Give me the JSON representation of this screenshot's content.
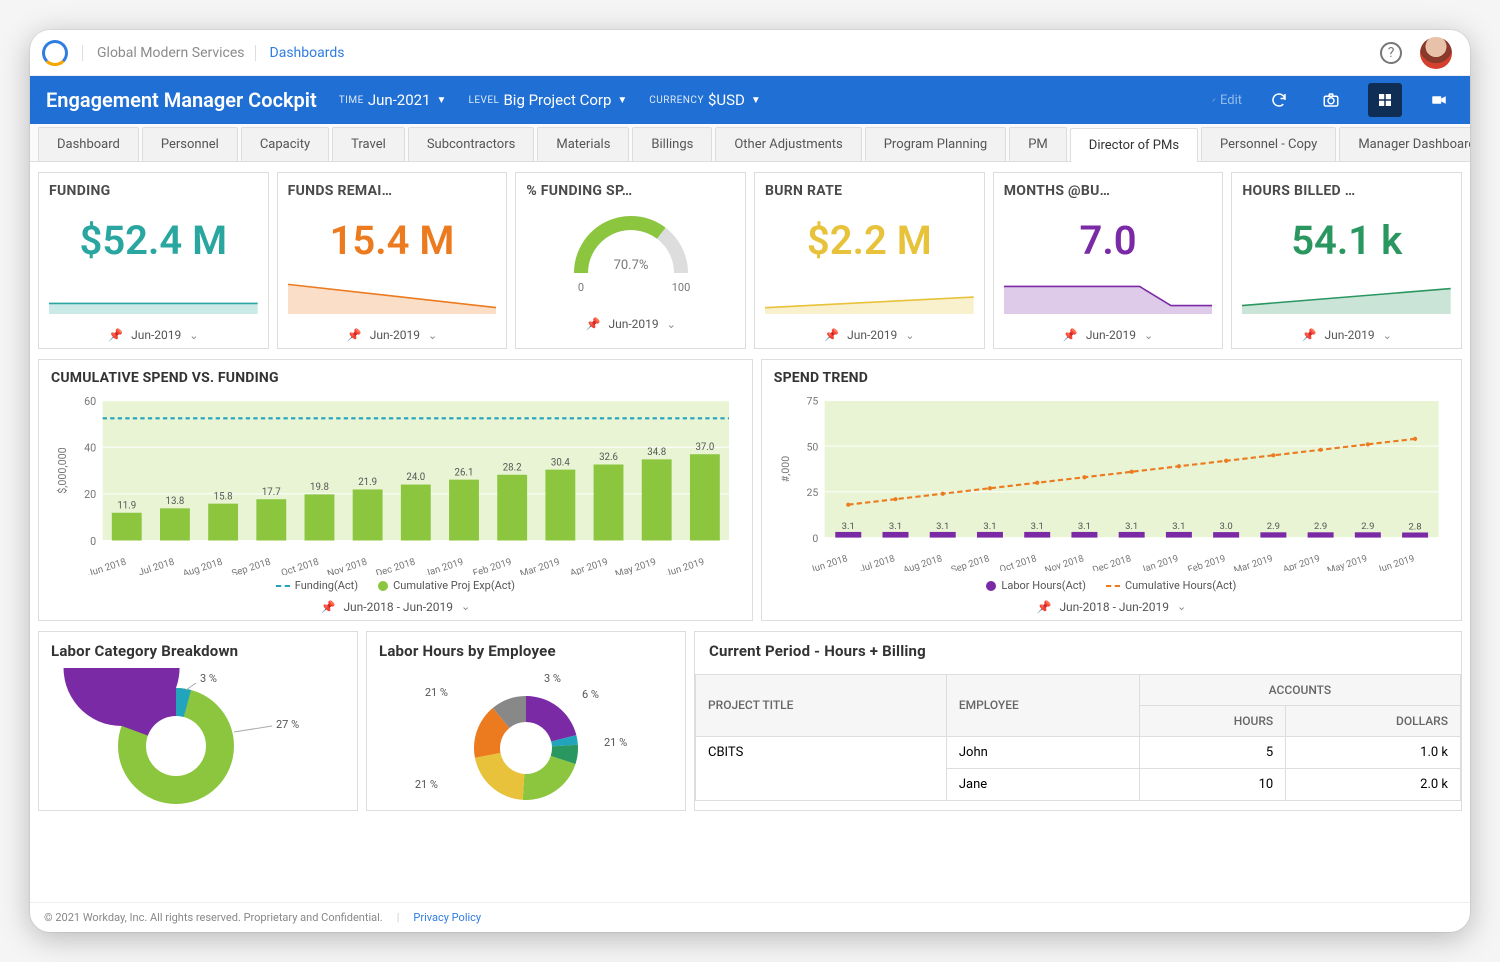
{
  "header": {
    "tenant": "Global Modern Services",
    "breadcrumb": "Dashboards"
  },
  "bluebar": {
    "title": "Engagement Manager Cockpit",
    "filters": {
      "time_label": "TIME",
      "time_value": "Jun-2021",
      "level_label": "LEVEL",
      "level_value": "Big Project Corp",
      "currency_label": "CURRENCY",
      "currency_value": "$USD"
    },
    "edit_label": "Edit"
  },
  "tabs": [
    "Dashboard",
    "Personnel",
    "Capacity",
    "Travel",
    "Subcontractors",
    "Materials",
    "Billings",
    "Other Adjustments",
    "Program Planning",
    "PM",
    "Director of PMs",
    "Personnel - Copy",
    "Manager Dashboard"
  ],
  "active_tab_index": 10,
  "kpis": [
    {
      "title": "FUNDING",
      "value": "$52.4 M",
      "color": "#2aa6a0",
      "date": "Jun-2019",
      "spark": "flat"
    },
    {
      "title": "FUNDS REMAI…",
      "value": "15.4 M",
      "color": "#ec7a1e",
      "date": "Jun-2019",
      "spark": "down"
    },
    {
      "title": "% FUNDING SP…",
      "gauge": {
        "pct": "70.7%",
        "min": "0",
        "max": "100",
        "fill_pct": 70.7,
        "arc_color": "#8cc63f"
      },
      "date": "Jun-2019"
    },
    {
      "title": "BURN RATE",
      "value": "$2.2 M",
      "color": "#e7c23a",
      "date": "Jun-2019",
      "spark": "up-yellow"
    },
    {
      "title": "MONTHS @BU…",
      "value": "7.0",
      "color": "#7b2aa6",
      "date": "Jun-2019",
      "spark": "drop-purple"
    },
    {
      "title": "HOURS BILLED …",
      "value": "54.1 k",
      "color": "#2a9660",
      "date": "Jun-2019",
      "spark": "up-green"
    }
  ],
  "cumulative": {
    "title": "CUMULATIVE SPEND VS. FUNDING",
    "ylabel": "$,000,000",
    "legend_funding": "Funding(Act)",
    "legend_exp": "Cumulative Proj Exp(Act)",
    "footer": "Jun-2018 - Jun-2019"
  },
  "spend_trend": {
    "title": "SPEND TREND",
    "ylabel": "#,000",
    "legend_labor": "Labor Hours(Act)",
    "legend_cum": "Cumulative Hours(Act)",
    "footer": "Jun-2018 - Jun-2019"
  },
  "labor_cat": {
    "title": "Labor Category Breakdown",
    "labels": {
      "a": "3 %",
      "b": "27 %"
    }
  },
  "labor_emp": {
    "title": "Labor Hours by Employee",
    "labels": {
      "a": "21 %",
      "b": "3 %",
      "c": "6 %",
      "d": "21 %",
      "e": "21 %"
    }
  },
  "table": {
    "title": "Current Period - Hours + Billing",
    "cols": {
      "proj": "PROJECT TITLE",
      "emp": "EMPLOYEE",
      "acc": "ACCOUNTS",
      "hours": "HOURS",
      "dollars": "DOLLARS"
    },
    "project": "CBITS",
    "rows": [
      {
        "emp": "John",
        "hours": "5",
        "dollars": "1.0 k"
      },
      {
        "emp": "Jane",
        "hours": "10",
        "dollars": "2.0 k"
      }
    ]
  },
  "footer": {
    "copyright": "© 2021 Workday, Inc. All rights reserved. Proprietary and Confidential.",
    "privacy": "Privacy Policy"
  },
  "chart_data": [
    {
      "type": "bar",
      "title": "CUMULATIVE SPEND VS. FUNDING",
      "ylabel": "$,000,000",
      "ylim": [
        0,
        60
      ],
      "yticks": [
        0,
        20,
        40,
        60
      ],
      "categories": [
        "Jun 2018",
        "Jul 2018",
        "Aug 2018",
        "Sep 2018",
        "Oct 2018",
        "Nov 2018",
        "Dec 2018",
        "Jan 2019",
        "Feb 2019",
        "Mar 2019",
        "Apr 2019",
        "May 2019",
        "Jun 2019"
      ],
      "series": [
        {
          "name": "Cumulative Proj Exp(Act)",
          "type": "bar",
          "values": [
            11.9,
            13.8,
            15.8,
            17.7,
            19.8,
            21.9,
            24.0,
            26.1,
            28.2,
            30.4,
            32.6,
            34.8,
            37.0
          ]
        },
        {
          "name": "Funding(Act)",
          "type": "line",
          "values": [
            52.4,
            52.4,
            52.4,
            52.4,
            52.4,
            52.4,
            52.4,
            52.4,
            52.4,
            52.4,
            52.4,
            52.4,
            52.4
          ]
        }
      ]
    },
    {
      "type": "line",
      "title": "SPEND TREND",
      "ylabel": "#,000",
      "ylim": [
        0,
        75
      ],
      "yticks": [
        0,
        25,
        50,
        75
      ],
      "categories": [
        "Jun 2018",
        "Jul 2018",
        "Aug 2018",
        "Sep 2018",
        "Oct 2018",
        "Nov 2018",
        "Dec 2018",
        "Jan 2019",
        "Feb 2019",
        "Mar 2019",
        "Apr 2019",
        "May 2019",
        "Jun 2019"
      ],
      "series": [
        {
          "name": "Labor Hours(Act)",
          "type": "bar",
          "values": [
            3.1,
            3.1,
            3.1,
            3.1,
            3.1,
            3.1,
            3.1,
            3.1,
            3.0,
            2.9,
            2.9,
            2.9,
            2.8
          ]
        },
        {
          "name": "Cumulative Hours(Act)",
          "type": "line",
          "values": [
            18,
            21,
            24,
            27,
            30,
            33,
            36,
            39,
            42,
            45,
            48,
            51,
            54
          ]
        }
      ]
    },
    {
      "type": "pie",
      "title": "Labor Category Breakdown",
      "slices": [
        {
          "label": "",
          "pct": 3
        },
        {
          "label": "",
          "pct": 27
        },
        {
          "label": "",
          "pct": 70
        }
      ]
    },
    {
      "type": "pie",
      "title": "Labor Hours by Employee",
      "slices": [
        {
          "label": "",
          "pct": 21
        },
        {
          "label": "",
          "pct": 3
        },
        {
          "label": "",
          "pct": 6
        },
        {
          "label": "",
          "pct": 21
        },
        {
          "label": "",
          "pct": 21
        },
        {
          "label": "",
          "pct": 17
        },
        {
          "label": "",
          "pct": 11
        }
      ]
    }
  ]
}
